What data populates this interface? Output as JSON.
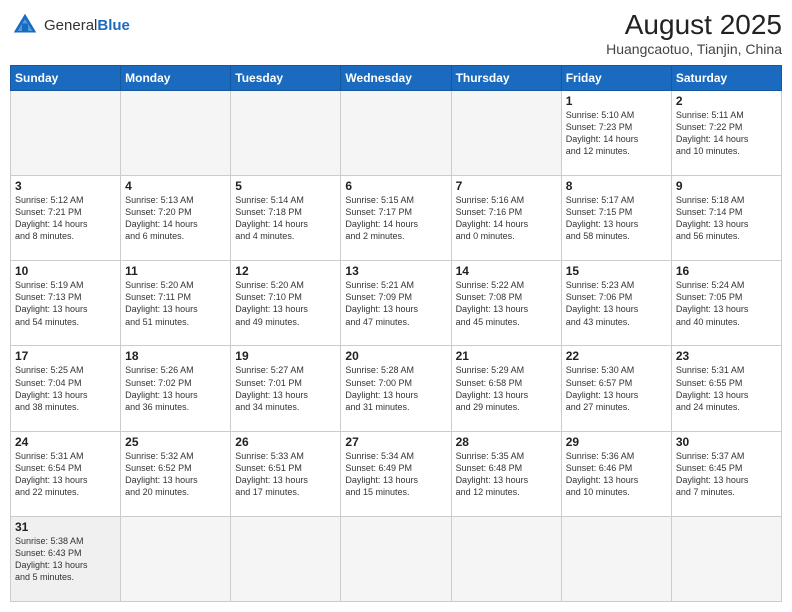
{
  "header": {
    "logo_general": "General",
    "logo_blue": "Blue",
    "title": "August 2025",
    "subtitle": "Huangcaotuo, Tianjin, China"
  },
  "weekdays": [
    "Sunday",
    "Monday",
    "Tuesday",
    "Wednesday",
    "Thursday",
    "Friday",
    "Saturday"
  ],
  "weeks": [
    [
      {
        "day": "",
        "info": ""
      },
      {
        "day": "",
        "info": ""
      },
      {
        "day": "",
        "info": ""
      },
      {
        "day": "",
        "info": ""
      },
      {
        "day": "",
        "info": ""
      },
      {
        "day": "1",
        "info": "Sunrise: 5:10 AM\nSunset: 7:23 PM\nDaylight: 14 hours\nand 12 minutes."
      },
      {
        "day": "2",
        "info": "Sunrise: 5:11 AM\nSunset: 7:22 PM\nDaylight: 14 hours\nand 10 minutes."
      }
    ],
    [
      {
        "day": "3",
        "info": "Sunrise: 5:12 AM\nSunset: 7:21 PM\nDaylight: 14 hours\nand 8 minutes."
      },
      {
        "day": "4",
        "info": "Sunrise: 5:13 AM\nSunset: 7:20 PM\nDaylight: 14 hours\nand 6 minutes."
      },
      {
        "day": "5",
        "info": "Sunrise: 5:14 AM\nSunset: 7:18 PM\nDaylight: 14 hours\nand 4 minutes."
      },
      {
        "day": "6",
        "info": "Sunrise: 5:15 AM\nSunset: 7:17 PM\nDaylight: 14 hours\nand 2 minutes."
      },
      {
        "day": "7",
        "info": "Sunrise: 5:16 AM\nSunset: 7:16 PM\nDaylight: 14 hours\nand 0 minutes."
      },
      {
        "day": "8",
        "info": "Sunrise: 5:17 AM\nSunset: 7:15 PM\nDaylight: 13 hours\nand 58 minutes."
      },
      {
        "day": "9",
        "info": "Sunrise: 5:18 AM\nSunset: 7:14 PM\nDaylight: 13 hours\nand 56 minutes."
      }
    ],
    [
      {
        "day": "10",
        "info": "Sunrise: 5:19 AM\nSunset: 7:13 PM\nDaylight: 13 hours\nand 54 minutes."
      },
      {
        "day": "11",
        "info": "Sunrise: 5:20 AM\nSunset: 7:11 PM\nDaylight: 13 hours\nand 51 minutes."
      },
      {
        "day": "12",
        "info": "Sunrise: 5:20 AM\nSunset: 7:10 PM\nDaylight: 13 hours\nand 49 minutes."
      },
      {
        "day": "13",
        "info": "Sunrise: 5:21 AM\nSunset: 7:09 PM\nDaylight: 13 hours\nand 47 minutes."
      },
      {
        "day": "14",
        "info": "Sunrise: 5:22 AM\nSunset: 7:08 PM\nDaylight: 13 hours\nand 45 minutes."
      },
      {
        "day": "15",
        "info": "Sunrise: 5:23 AM\nSunset: 7:06 PM\nDaylight: 13 hours\nand 43 minutes."
      },
      {
        "day": "16",
        "info": "Sunrise: 5:24 AM\nSunset: 7:05 PM\nDaylight: 13 hours\nand 40 minutes."
      }
    ],
    [
      {
        "day": "17",
        "info": "Sunrise: 5:25 AM\nSunset: 7:04 PM\nDaylight: 13 hours\nand 38 minutes."
      },
      {
        "day": "18",
        "info": "Sunrise: 5:26 AM\nSunset: 7:02 PM\nDaylight: 13 hours\nand 36 minutes."
      },
      {
        "day": "19",
        "info": "Sunrise: 5:27 AM\nSunset: 7:01 PM\nDaylight: 13 hours\nand 34 minutes."
      },
      {
        "day": "20",
        "info": "Sunrise: 5:28 AM\nSunset: 7:00 PM\nDaylight: 13 hours\nand 31 minutes."
      },
      {
        "day": "21",
        "info": "Sunrise: 5:29 AM\nSunset: 6:58 PM\nDaylight: 13 hours\nand 29 minutes."
      },
      {
        "day": "22",
        "info": "Sunrise: 5:30 AM\nSunset: 6:57 PM\nDaylight: 13 hours\nand 27 minutes."
      },
      {
        "day": "23",
        "info": "Sunrise: 5:31 AM\nSunset: 6:55 PM\nDaylight: 13 hours\nand 24 minutes."
      }
    ],
    [
      {
        "day": "24",
        "info": "Sunrise: 5:31 AM\nSunset: 6:54 PM\nDaylight: 13 hours\nand 22 minutes."
      },
      {
        "day": "25",
        "info": "Sunrise: 5:32 AM\nSunset: 6:52 PM\nDaylight: 13 hours\nand 20 minutes."
      },
      {
        "day": "26",
        "info": "Sunrise: 5:33 AM\nSunset: 6:51 PM\nDaylight: 13 hours\nand 17 minutes."
      },
      {
        "day": "27",
        "info": "Sunrise: 5:34 AM\nSunset: 6:49 PM\nDaylight: 13 hours\nand 15 minutes."
      },
      {
        "day": "28",
        "info": "Sunrise: 5:35 AM\nSunset: 6:48 PM\nDaylight: 13 hours\nand 12 minutes."
      },
      {
        "day": "29",
        "info": "Sunrise: 5:36 AM\nSunset: 6:46 PM\nDaylight: 13 hours\nand 10 minutes."
      },
      {
        "day": "30",
        "info": "Sunrise: 5:37 AM\nSunset: 6:45 PM\nDaylight: 13 hours\nand 7 minutes."
      }
    ],
    [
      {
        "day": "31",
        "info": "Sunrise: 5:38 AM\nSunset: 6:43 PM\nDaylight: 13 hours\nand 5 minutes."
      },
      {
        "day": "",
        "info": ""
      },
      {
        "day": "",
        "info": ""
      },
      {
        "day": "",
        "info": ""
      },
      {
        "day": "",
        "info": ""
      },
      {
        "day": "",
        "info": ""
      },
      {
        "day": "",
        "info": ""
      }
    ]
  ]
}
